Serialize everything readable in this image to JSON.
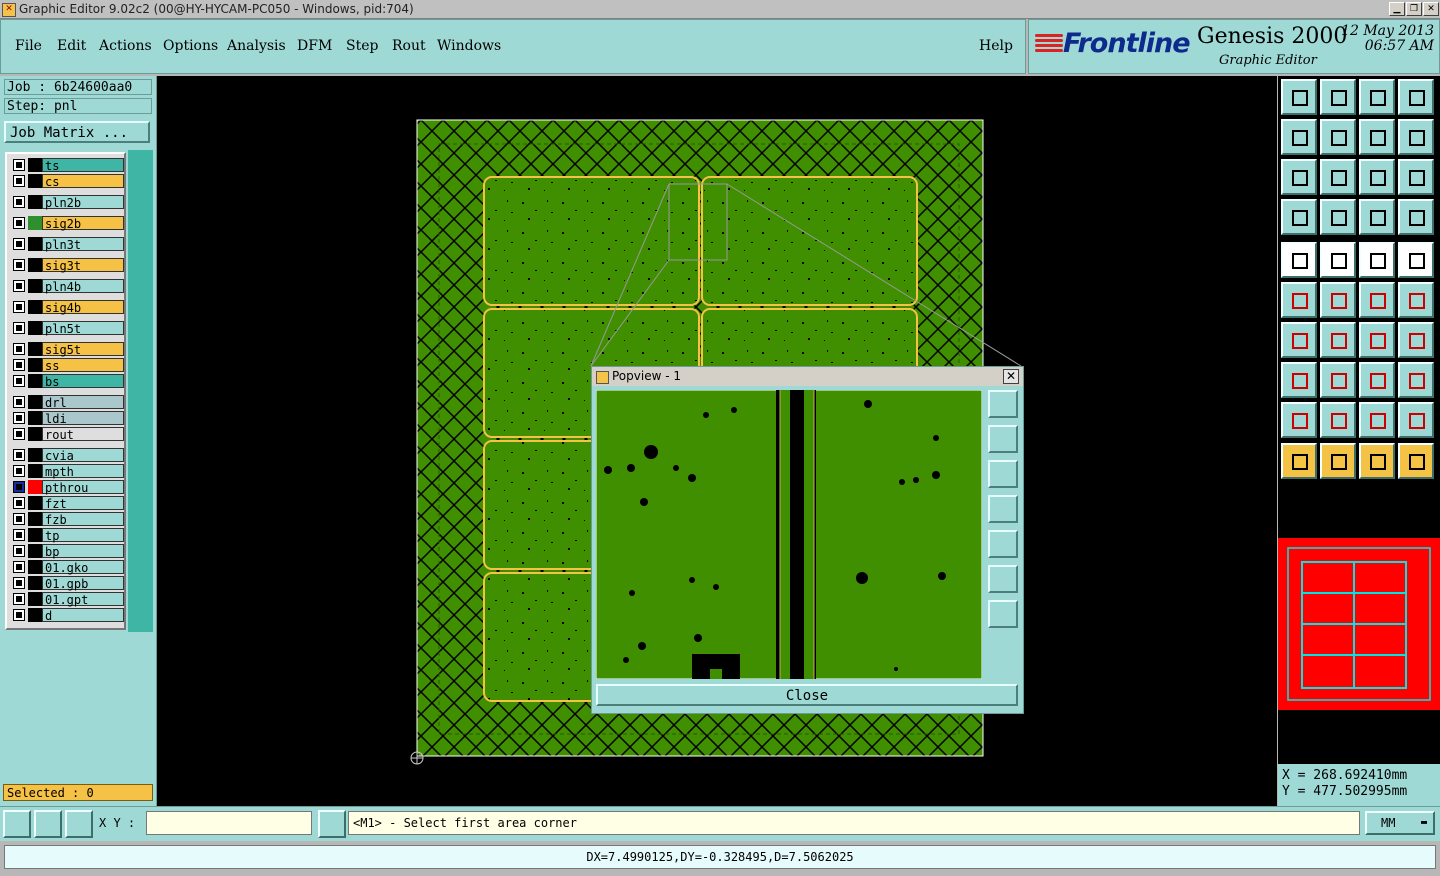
{
  "window": {
    "title": "Graphic Editor 9.02c2 (00@HY-HYCAM-PC050 - Windows, pid:704)"
  },
  "menu": [
    "File",
    "Edit",
    "Actions",
    "Options",
    "Analysis",
    "DFM",
    "Step",
    "Rout",
    "Windows"
  ],
  "help_label": "Help",
  "brand": {
    "logo": "Frontline",
    "product": "Genesis 2000",
    "subtitle": "Graphic Editor",
    "date": "12 May 2013",
    "time": "06:57 AM"
  },
  "job": {
    "label": "Job : 6b24600aa0",
    "step": "Step: pnl",
    "matrix_button": "Job Matrix ..."
  },
  "layers": [
    {
      "name": "ts",
      "color": "#3fb6a5",
      "swatch": "#000000"
    },
    {
      "name": "cs",
      "color": "#f6c245",
      "swatch": "#000000"
    },
    {
      "name": "pln2b",
      "color": "#9fd9d5",
      "swatch": "#000000"
    },
    {
      "name": "sig2b",
      "color": "#f6c245",
      "swatch": "#2f8f2f"
    },
    {
      "name": "pln3t",
      "color": "#9fd9d5",
      "swatch": "#000000"
    },
    {
      "name": "sig3t",
      "color": "#f6c245",
      "swatch": "#000000"
    },
    {
      "name": "pln4b",
      "color": "#9fd9d5",
      "swatch": "#000000"
    },
    {
      "name": "sig4b",
      "color": "#f6c245",
      "swatch": "#000000"
    },
    {
      "name": "pln5t",
      "color": "#9fd9d5",
      "swatch": "#000000"
    },
    {
      "name": "sig5t",
      "color": "#f6c245",
      "swatch": "#000000"
    },
    {
      "name": "ss",
      "color": "#f6c245",
      "swatch": "#000000"
    },
    {
      "name": "bs",
      "color": "#3fb6a5",
      "swatch": "#000000"
    },
    {
      "name": "drl",
      "color": "#aac8cc",
      "swatch": "#000000"
    },
    {
      "name": "ldi",
      "color": "#aac8cc",
      "swatch": "#000000"
    },
    {
      "name": "rout",
      "color": "#dedede",
      "swatch": "#000000"
    },
    {
      "name": "cvia",
      "color": "#9fd9d5",
      "swatch": "#000000"
    },
    {
      "name": "mpth",
      "color": "#9fd9d5",
      "swatch": "#000000"
    },
    {
      "name": "pthrou",
      "color": "#9fd9d5",
      "swatch": "#ff0000",
      "active": true
    },
    {
      "name": "fzt",
      "color": "#9fd9d5",
      "swatch": "#000000"
    },
    {
      "name": "fzb",
      "color": "#9fd9d5",
      "swatch": "#000000"
    },
    {
      "name": "tp",
      "color": "#9fd9d5",
      "swatch": "#000000"
    },
    {
      "name": "bp",
      "color": "#9fd9d5",
      "swatch": "#000000"
    },
    {
      "name": "01.gko",
      "color": "#9fd9d5",
      "swatch": "#000000"
    },
    {
      "name": "01.gpb",
      "color": "#9fd9d5",
      "swatch": "#000000"
    },
    {
      "name": "01.gpt",
      "color": "#9fd9d5",
      "swatch": "#000000"
    },
    {
      "name": "d",
      "color": "#9fd9d5",
      "swatch": "#000000"
    }
  ],
  "selected": "Selected : 0",
  "popview": {
    "title": "Popview - 1",
    "close_label": "Close"
  },
  "coords": {
    "x": "X = 268.692410mm",
    "y": "Y = 477.502995mm"
  },
  "bottom": {
    "xy_label": "X Y :",
    "xy_value": "",
    "prompt": "<M1> - Select first area corner",
    "units": "MM"
  },
  "status": "DX=7.4990125,DY=-0.328495,D=7.5062025",
  "colors": {
    "panel": "#9fd9d5",
    "board_green": "#3f8f00",
    "highlight_orange": "#f6c245",
    "canvas": "#000000"
  }
}
